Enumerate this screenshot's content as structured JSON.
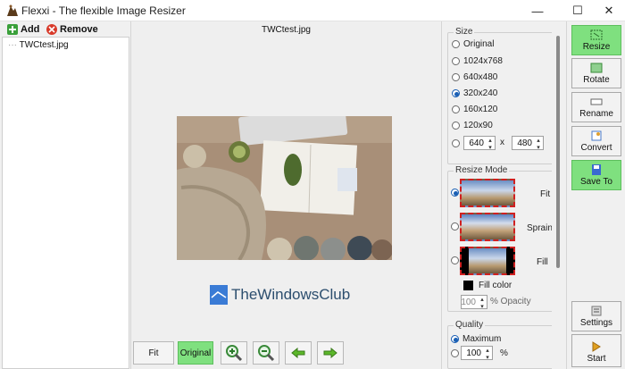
{
  "window": {
    "title": "Flexxi - The flexible Image Resizer",
    "minimize": "—",
    "maximize": "☐",
    "close": "✕"
  },
  "toolbar": {
    "add_label": "Add",
    "remove_label": "Remove"
  },
  "files": [
    {
      "name": "TWCtest.jpg"
    }
  ],
  "preview": {
    "filename": "TWCtest.jpg"
  },
  "watermark": {
    "text": "TheWindowsClub"
  },
  "bottom_buttons": {
    "fit": "Fit",
    "original": "Original"
  },
  "size": {
    "title": "Size",
    "options": [
      "Original",
      "1024x768",
      "640x480",
      "320x240",
      "160x120",
      "120x90"
    ],
    "selected": "320x240",
    "custom_width": "640",
    "custom_x": "x",
    "custom_height": "480"
  },
  "resize_mode": {
    "title": "Resize Mode",
    "modes": [
      "Fit",
      "Sprain",
      "Fill"
    ],
    "selected": "Fit",
    "fill_color_label": "Fill color",
    "fill_color": "#000000",
    "opacity_value": "100",
    "opacity_label": "% Opacity"
  },
  "quality": {
    "title": "Quality",
    "maximum_label": "Maximum",
    "custom_value": "100",
    "unit": "%"
  },
  "commands": {
    "resize": "Resize",
    "rotate": "Rotate",
    "rename": "Rename",
    "convert": "Convert",
    "save_to": "Save To",
    "settings": "Settings",
    "start": "Start"
  },
  "colors": {
    "accent_green": "#7fe07f",
    "selection_blue": "#1a5fb4",
    "thumb_border": "#d02020"
  }
}
